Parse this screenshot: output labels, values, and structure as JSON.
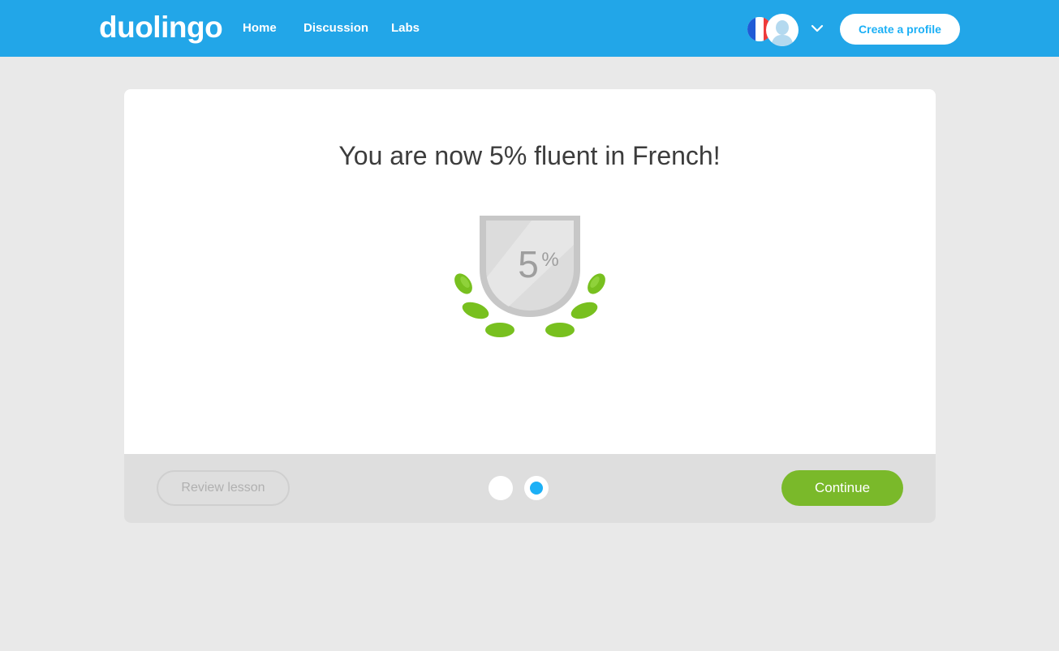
{
  "header": {
    "logo": "duolingo",
    "nav": [
      {
        "label": "Home"
      },
      {
        "label": "Discussion"
      },
      {
        "label": "Labs"
      }
    ],
    "create_profile_label": "Create a profile",
    "language_icon": "france-flag-icon",
    "avatar_icon": "user-avatar-icon",
    "dropdown_icon": "chevron-down-icon"
  },
  "lesson_complete": {
    "headline": "You are now 5% fluent in French!",
    "badge_percent": "5",
    "badge_percent_sign": "%",
    "badge_icon": "fluency-shield-laurel-icon"
  },
  "footer": {
    "review_label": "Review lesson",
    "continue_label": "Continue",
    "progress_steps": 2,
    "current_step": 2
  },
  "colors": {
    "header_bg": "#22a6e8",
    "accent_blue": "#1cb0f6",
    "continue_green": "#7ab92a",
    "laurel_green": "#78c01f",
    "badge_gray": "#c9c9c9",
    "page_bg": "#e9e9e9"
  }
}
